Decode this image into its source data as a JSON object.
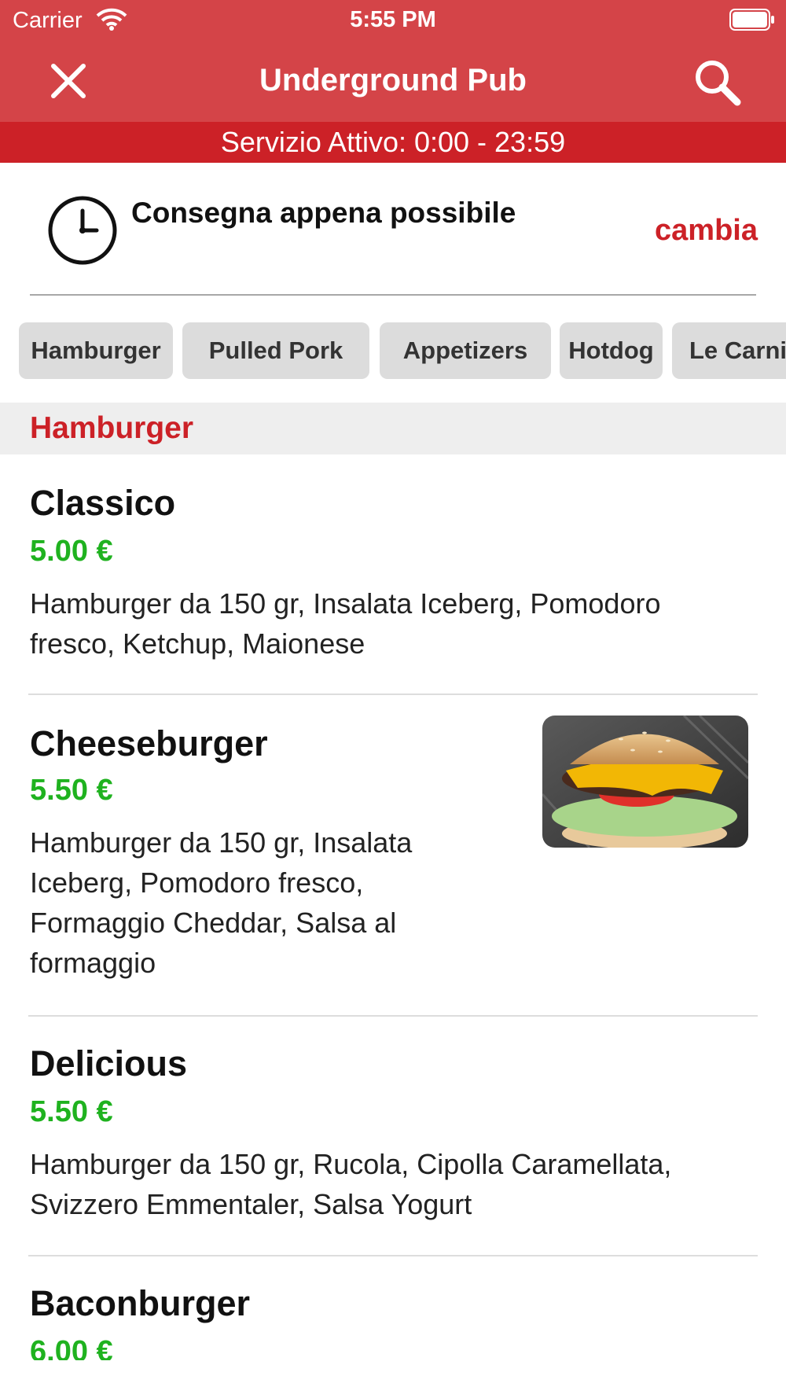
{
  "status_bar": {
    "carrier": "Carrier",
    "time": "5:55 PM",
    "wifi_icon": "wifi-icon",
    "battery_icon": "battery-icon"
  },
  "nav": {
    "title": "Underground Pub",
    "close_icon": "close-icon",
    "search_icon": "search-icon"
  },
  "service_banner": "Servizio Attivo: 0:00 - 23:59",
  "delivery": {
    "label": "Consegna appena possibile",
    "change_label": "cambia",
    "clock_icon": "clock-icon"
  },
  "categories": [
    {
      "label": "Hamburger"
    },
    {
      "label": "Pulled Pork"
    },
    {
      "label": "Appetizers"
    },
    {
      "label": "Hotdog"
    },
    {
      "label": "Le Carni"
    }
  ],
  "section": {
    "title": "Hamburger"
  },
  "products": [
    {
      "name": "Classico",
      "price": "5.00 €",
      "desc_lines": [
        "Hamburger da 150 gr, Insalata Iceberg, Pomodoro",
        "fresco, Ketchup, Maionese"
      ]
    },
    {
      "name": "Cheeseburger",
      "price": "5.50 €",
      "desc_lines": [
        "Hamburger da 150 gr, Insalata",
        "Iceberg, Pomodoro fresco,",
        "Formaggio Cheddar, Salsa al",
        "formaggio"
      ],
      "image": "cheeseburger-photo"
    },
    {
      "name": "Delicious",
      "price": "5.50 €",
      "desc_lines": [
        "Hamburger da 150 gr, Rucola, Cipolla Caramellata,",
        "Svizzero Emmentaler, Salsa Yogurt"
      ]
    },
    {
      "name": "Baconburger",
      "price": "6.00 €"
    }
  ],
  "colors": {
    "header_red": "#d44448",
    "banner_red": "#cc2127",
    "price_green": "#1fb21f",
    "chip_gray": "#dcdcdc"
  }
}
